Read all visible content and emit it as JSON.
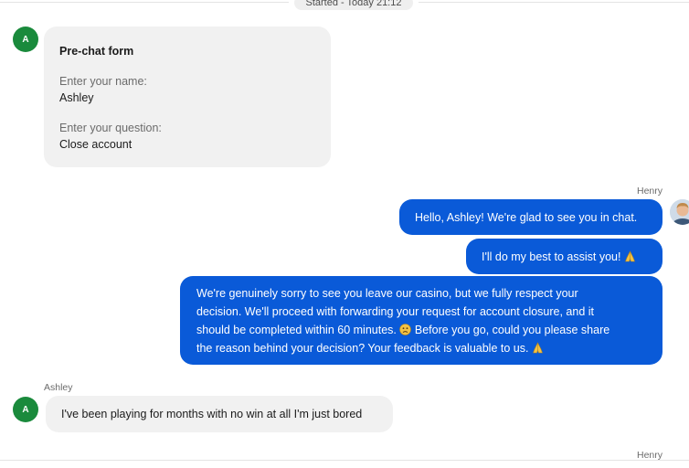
{
  "session": {
    "started_label": "Started - Today 21:12"
  },
  "customer": {
    "name": "Ashley",
    "avatar_initial": "A"
  },
  "agent": {
    "name": "Henry"
  },
  "prechat": {
    "title": "Pre-chat form",
    "name_label": "Enter your name:",
    "name_value": "Ashley",
    "question_label": "Enter your question:",
    "question_value": "Close account"
  },
  "messages": {
    "agent_1": "Hello, Ashley! We're glad to see you in chat.",
    "agent_2": "I'll do my best to assist you!",
    "agent_3_line_1": "We're genuinely sorry to see you leave our casino, but we fully respect your",
    "agent_3_line_2": "decision. We'll proceed with forwarding your request for account closure, and it",
    "agent_3_line_3": "should be completed within 60 minutes.",
    "agent_3_line_3b": "Before you go, could you please share",
    "agent_3_line_4": "the reason behind your decision? Your feedback is valuable to us.",
    "customer_1": "I've been playing for months with no win at all I'm just bored"
  },
  "colors": {
    "agent_bubble": "#0a5ad8",
    "customer_bubble": "#f1f1f1",
    "customer_avatar": "#1a8a3c"
  },
  "icons": {
    "pray": "folded-hands-icon",
    "sad": "sad-face-icon"
  }
}
